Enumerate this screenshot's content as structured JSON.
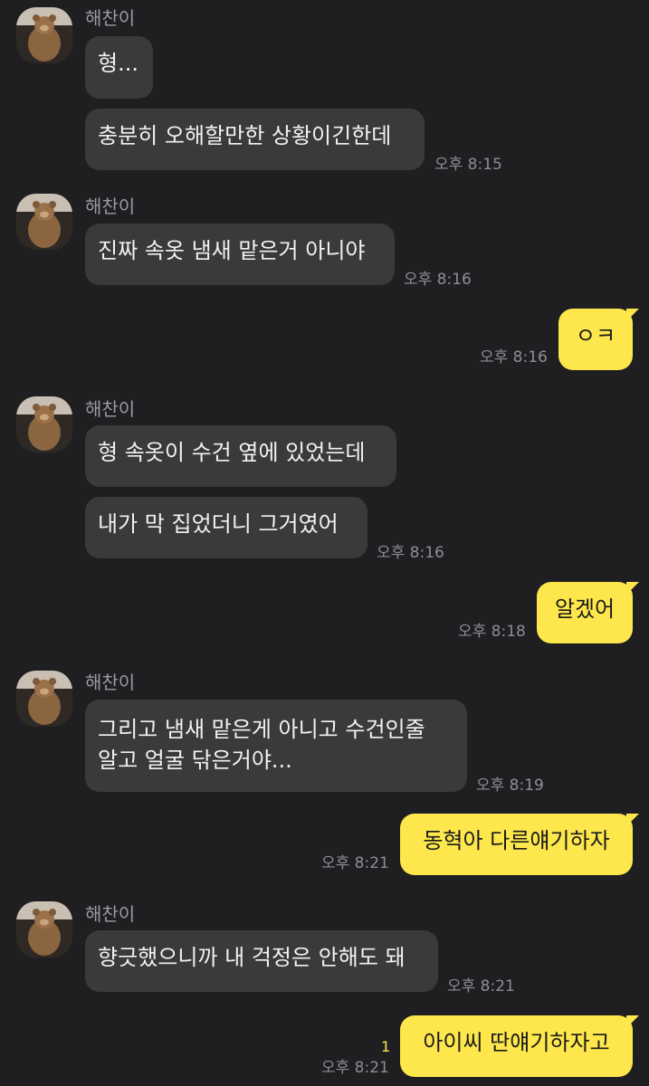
{
  "sender_name": "해찬이",
  "colors": {
    "background": "#1f1f21",
    "incoming_bubble": "#3a3a3d",
    "outgoing_bubble": "#fde74c",
    "timestamp": "#8e8e93"
  },
  "messages": [
    {
      "text": "형..."
    },
    {
      "text": "충분히 오해할만한 상황이긴한데",
      "time": "오후 8:15"
    },
    {
      "text": "진짜 속옷 냄새 맡은거 아니야",
      "time": "오후 8:16"
    },
    {
      "text": "ㅇㅋ",
      "time": "오후 8:16"
    },
    {
      "text": "형 속옷이 수건 옆에 있었는데"
    },
    {
      "text": "내가 막 집었더니 그거였어",
      "time": "오후 8:16"
    },
    {
      "text": "알겠어",
      "time": "오후 8:18"
    },
    {
      "line1": "그리고 냄새 맡은게 아니고 수건인줄",
      "line2": "알고 얼굴 닦은거야...",
      "time": "오후 8:19"
    },
    {
      "text": "동혁아 다른얘기하자",
      "time": "오후 8:21"
    },
    {
      "text": "향긋했으니까 내 걱정은 안해도 돼",
      "time": "오후 8:21"
    },
    {
      "text": "아이씨 딴얘기하자고",
      "time": "오후 8:21",
      "unread_count": "1"
    }
  ]
}
